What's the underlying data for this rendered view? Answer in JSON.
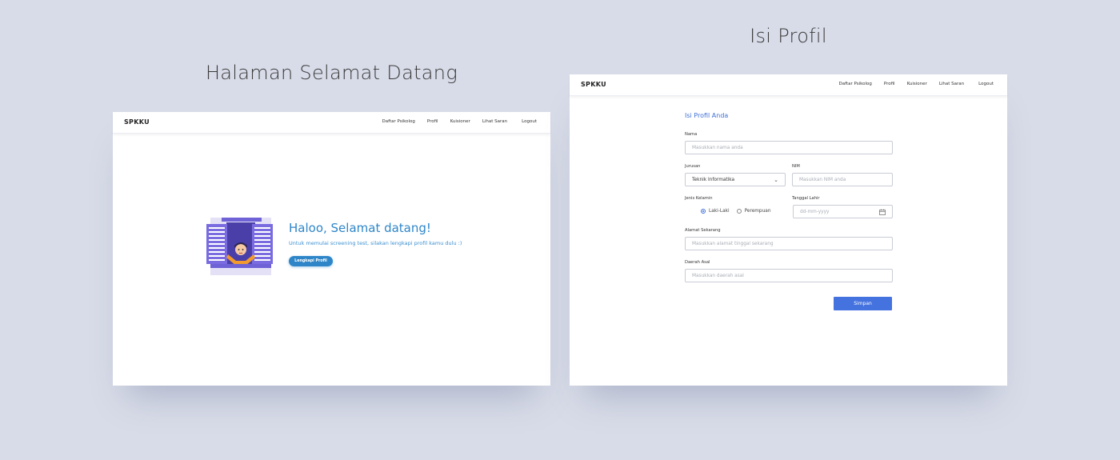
{
  "captions": {
    "left": "Halaman Selamat Datang",
    "right": "Isi Profil"
  },
  "nav": {
    "brand": "SPKKU",
    "links": [
      "Daftar Psikolog",
      "Profil",
      "Kuisioner",
      "Lihat Saran",
      "Logout"
    ]
  },
  "welcome": {
    "title": "Haloo, Selamat datang!",
    "subtitle": "Untuk memulai screening test, silakan lengkapi profil kamu dulu :)",
    "button": "Lengkapi Profil"
  },
  "profile_form": {
    "title": "Isi Profil Anda",
    "nama": {
      "label": "Nama",
      "placeholder": "Masukkan nama anda"
    },
    "jurusan": {
      "label": "Jurusan",
      "value": "Teknik Informatika"
    },
    "nim": {
      "label": "NIM",
      "placeholder": "Masukkan NIM anda"
    },
    "jenis_kelamin": {
      "label": "Jenis Kelamin",
      "options": [
        "Laki-Laki",
        "Perempuan"
      ],
      "selected": "Laki-Laki"
    },
    "tanggal_lahir": {
      "label": "Tanggal Lahir",
      "placeholder": "dd-mm-yyyy"
    },
    "alamat": {
      "label": "Alamat Sekarang",
      "placeholder": "Masukkan alamat tinggal sekarang"
    },
    "daerah": {
      "label": "Daerah Asal",
      "placeholder": "Masukkan daerah asal"
    },
    "submit": "Simpan"
  },
  "colors": {
    "background": "#d8dce8",
    "welcome_accent": "#2e86c8",
    "form_accent": "#4472df"
  },
  "icons": [
    "window-character-illustration",
    "chevron-down-icon",
    "calendar-icon"
  ]
}
